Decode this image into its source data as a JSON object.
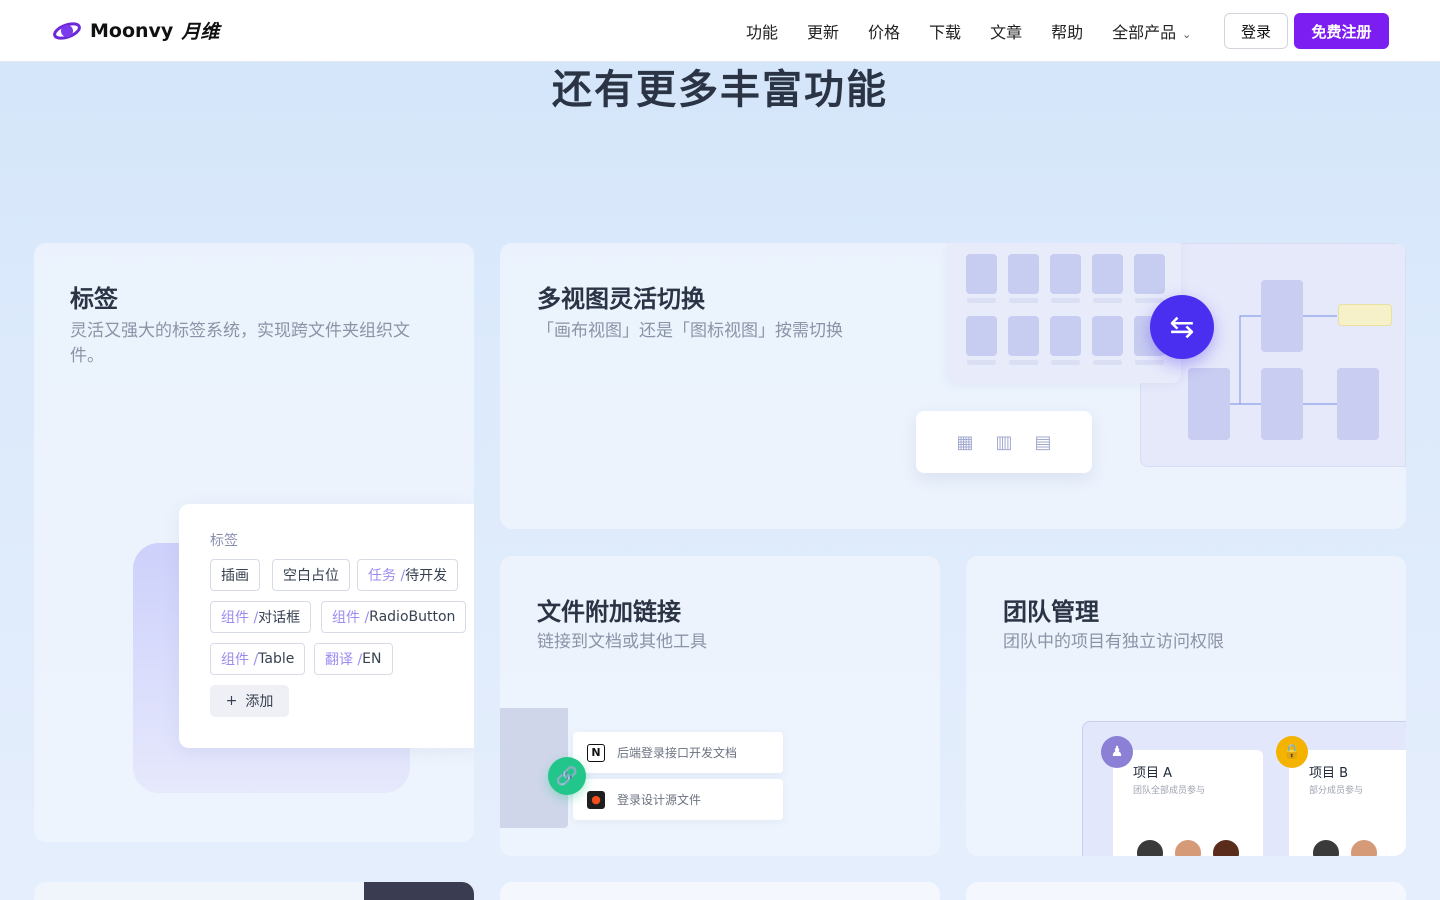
{
  "nav": {
    "brand": "Moonvy",
    "brand_cn": "月维",
    "links": [
      "功能",
      "更新",
      "价格",
      "下载",
      "文章",
      "帮助",
      "全部产品"
    ],
    "login": "登录",
    "signup": "免费注册"
  },
  "heading": "还有更多丰富功能",
  "tags_card": {
    "title": "标签",
    "desc": "灵活又强大的标签系统，实现跨文件夹组织文件。",
    "panel_label": "标签",
    "tags": [
      {
        "pre": "",
        "text": "插画"
      },
      {
        "pre": "",
        "text": "空白占位"
      },
      {
        "pre": "任务 / ",
        "text": "待开发"
      },
      {
        "pre": "组件 / ",
        "text": "对话框"
      },
      {
        "pre": "组件 / ",
        "text": "RadioButton"
      },
      {
        "pre": "组件 / ",
        "text": "Table"
      },
      {
        "pre": "翻译 / ",
        "text": "EN"
      }
    ],
    "add": "添加"
  },
  "multiview_card": {
    "title": "多视图灵活切换",
    "desc": "「画布视图」还是「图标视图」按需切换"
  },
  "filelink_card": {
    "title": "文件附加链接",
    "desc": "链接到文档或其他工具",
    "links": [
      "后端登录接口开发文档",
      "登录设计源文件"
    ]
  },
  "team_card": {
    "title": "团队管理",
    "desc": "团队中的项目有独立访问权限",
    "projects": [
      {
        "name": "项目 A",
        "sub": "团队全部成员参与"
      },
      {
        "name": "项目 B",
        "sub": "部分成员参与"
      }
    ]
  },
  "colors": {
    "accent": "#7c1ef2",
    "switch": "#4a2ff0",
    "link": "#22c58a",
    "lock": "#f5b301"
  }
}
